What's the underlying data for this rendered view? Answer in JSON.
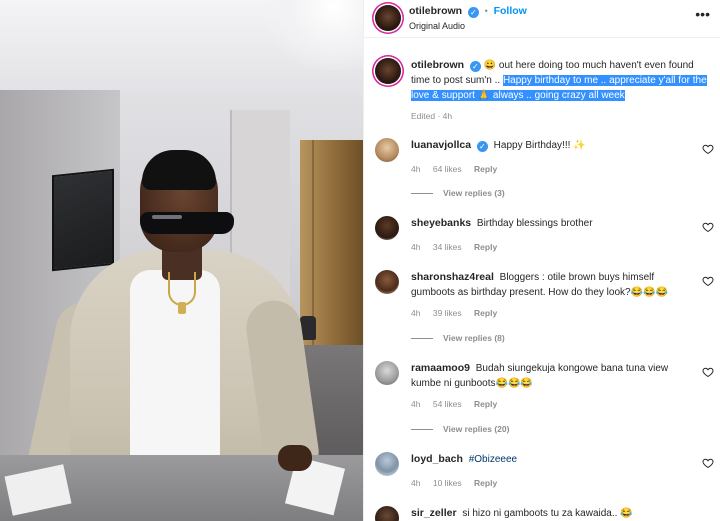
{
  "header": {
    "username": "otilebrown",
    "follow_label": "Follow",
    "separator": "•",
    "audio": "Original Audio",
    "more": "•••"
  },
  "caption": {
    "username": "otilebrown",
    "text_plain": "😀 out here doing too much haven't even found time to post sum'n .. ",
    "text_highlighted": "Happy birthday to me .. appreciate y'all for the love & support 🙏 always .. going crazy all week",
    "edited": "Edited · 4h"
  },
  "comments": [
    {
      "username": "luanavjollca",
      "verified": true,
      "text": "Happy Birthday!!! ✨",
      "time": "4h",
      "likes": "64 likes",
      "reply": "Reply",
      "view_replies": "View replies (3)"
    },
    {
      "username": "sheyebanks",
      "verified": false,
      "text": "Birthday blessings brother",
      "time": "4h",
      "likes": "34 likes",
      "reply": "Reply",
      "view_replies": ""
    },
    {
      "username": "sharonshaz4real",
      "verified": false,
      "text": "Bloggers : otile brown buys himself gumboots as birthday present. How do they look?😂😂😂",
      "time": "4h",
      "likes": "39 likes",
      "reply": "Reply",
      "view_replies": "View replies (8)"
    },
    {
      "username": "ramaamoo9",
      "verified": false,
      "text": "Budah siungekuja kongowe bana tuna view kumbe ni gunboots😂😂😂",
      "time": "4h",
      "likes": "54 likes",
      "reply": "Reply",
      "view_replies": "View replies (20)"
    },
    {
      "username": "loyd_bach",
      "verified": false,
      "text": "#Obizeeee",
      "time": "4h",
      "likes": "10 likes",
      "reply": "Reply",
      "view_replies": ""
    },
    {
      "username": "sir_zeller",
      "verified": false,
      "text": "si hizo ni gamboots tu za kawaida.. 😂",
      "time": "",
      "likes": "",
      "reply": "",
      "view_replies": ""
    }
  ],
  "colors": {
    "link_blue": "#0095f6",
    "highlight": "#3390ff",
    "verified": "#3897f0",
    "muted": "#8e8e8e"
  }
}
